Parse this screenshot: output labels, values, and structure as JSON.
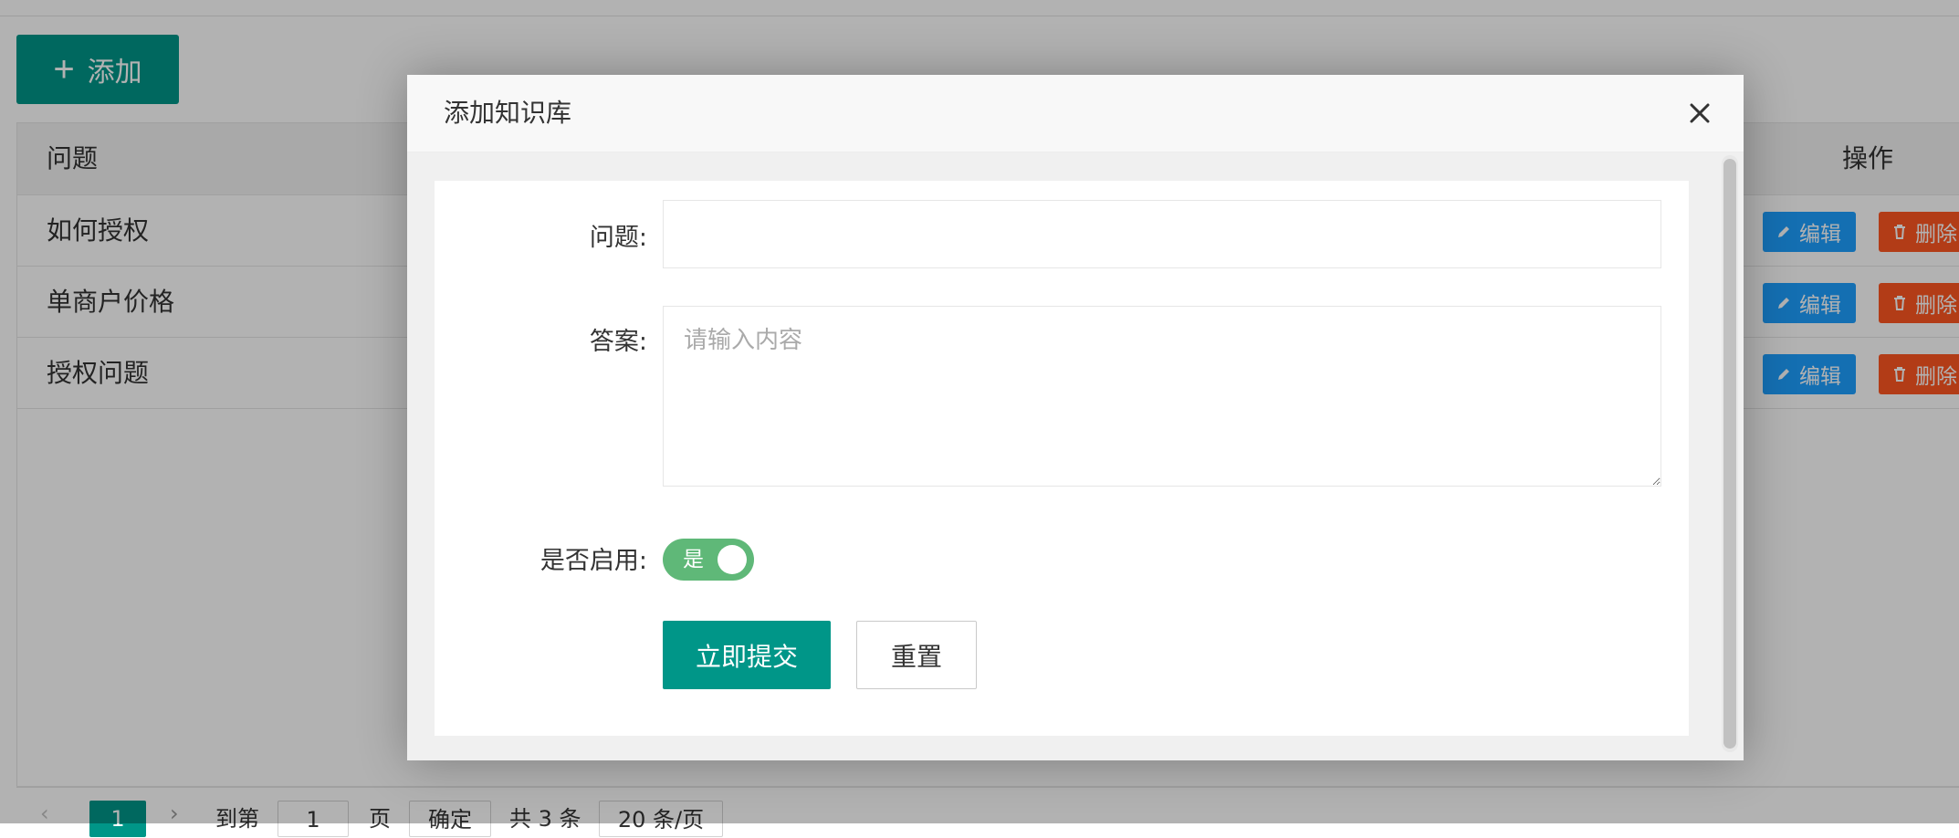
{
  "toolbar": {
    "add_label": "添加",
    "add_icon": "plus-icon"
  },
  "table": {
    "columns": [
      "问题",
      "操作"
    ],
    "rows": [
      {
        "question": "如何授权"
      },
      {
        "question": "单商户价格"
      },
      {
        "question": "授权问题"
      }
    ],
    "edit_label": "编辑",
    "delete_label": "删除"
  },
  "pager": {
    "current_page": "1",
    "goto_prefix": "到第",
    "goto_value": "1",
    "goto_suffix": "页",
    "confirm_label": "确定",
    "total_text": "共 3 条",
    "page_size": "20 条/页"
  },
  "modal": {
    "title": "添加知识库",
    "question_label": "问题:",
    "question_value": "",
    "answer_label": "答案:",
    "answer_placeholder": "请输入内容",
    "enabled_label": "是否启用:",
    "switch_text": "是",
    "submit_label": "立即提交",
    "reset_label": "重置"
  },
  "colors": {
    "primary": "#009688",
    "edit": "#1e9fff",
    "danger": "#ff5722",
    "switch_on": "#5fb878"
  }
}
